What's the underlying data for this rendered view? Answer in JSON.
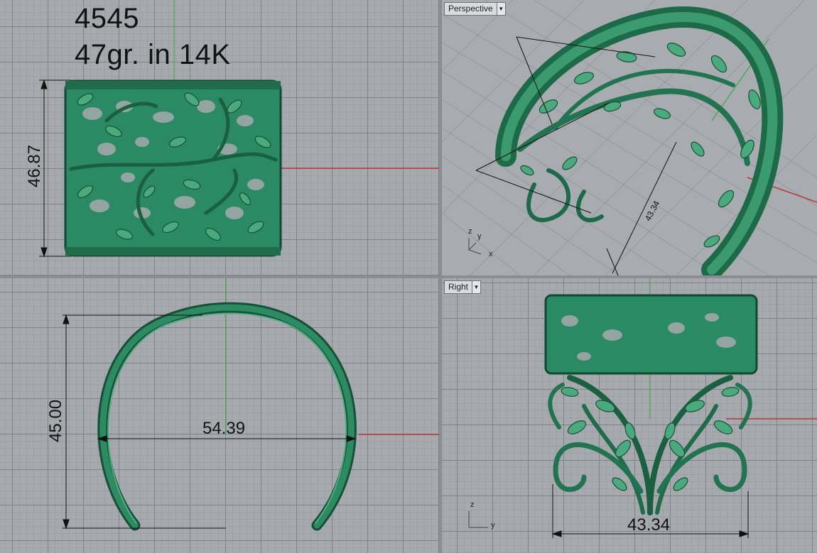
{
  "viewports": {
    "top": {
      "label": "",
      "annotation_model": "4545",
      "annotation_weight": "47gr. in 14K",
      "dim_height": "46.87"
    },
    "perspective": {
      "label": "Perspective",
      "dim_span": "43.34"
    },
    "front": {
      "label": "",
      "dim_height": "45.00",
      "dim_width": "54.39"
    },
    "right": {
      "label": "Right",
      "dim_width": "43.34"
    }
  },
  "icons": {
    "dropdown": "chevron-down-icon"
  },
  "colors": {
    "model_green": "#27805c",
    "x_axis": "#b8383a",
    "y_axis": "#3aa83f",
    "grid_bg": "#a6a9ae"
  }
}
